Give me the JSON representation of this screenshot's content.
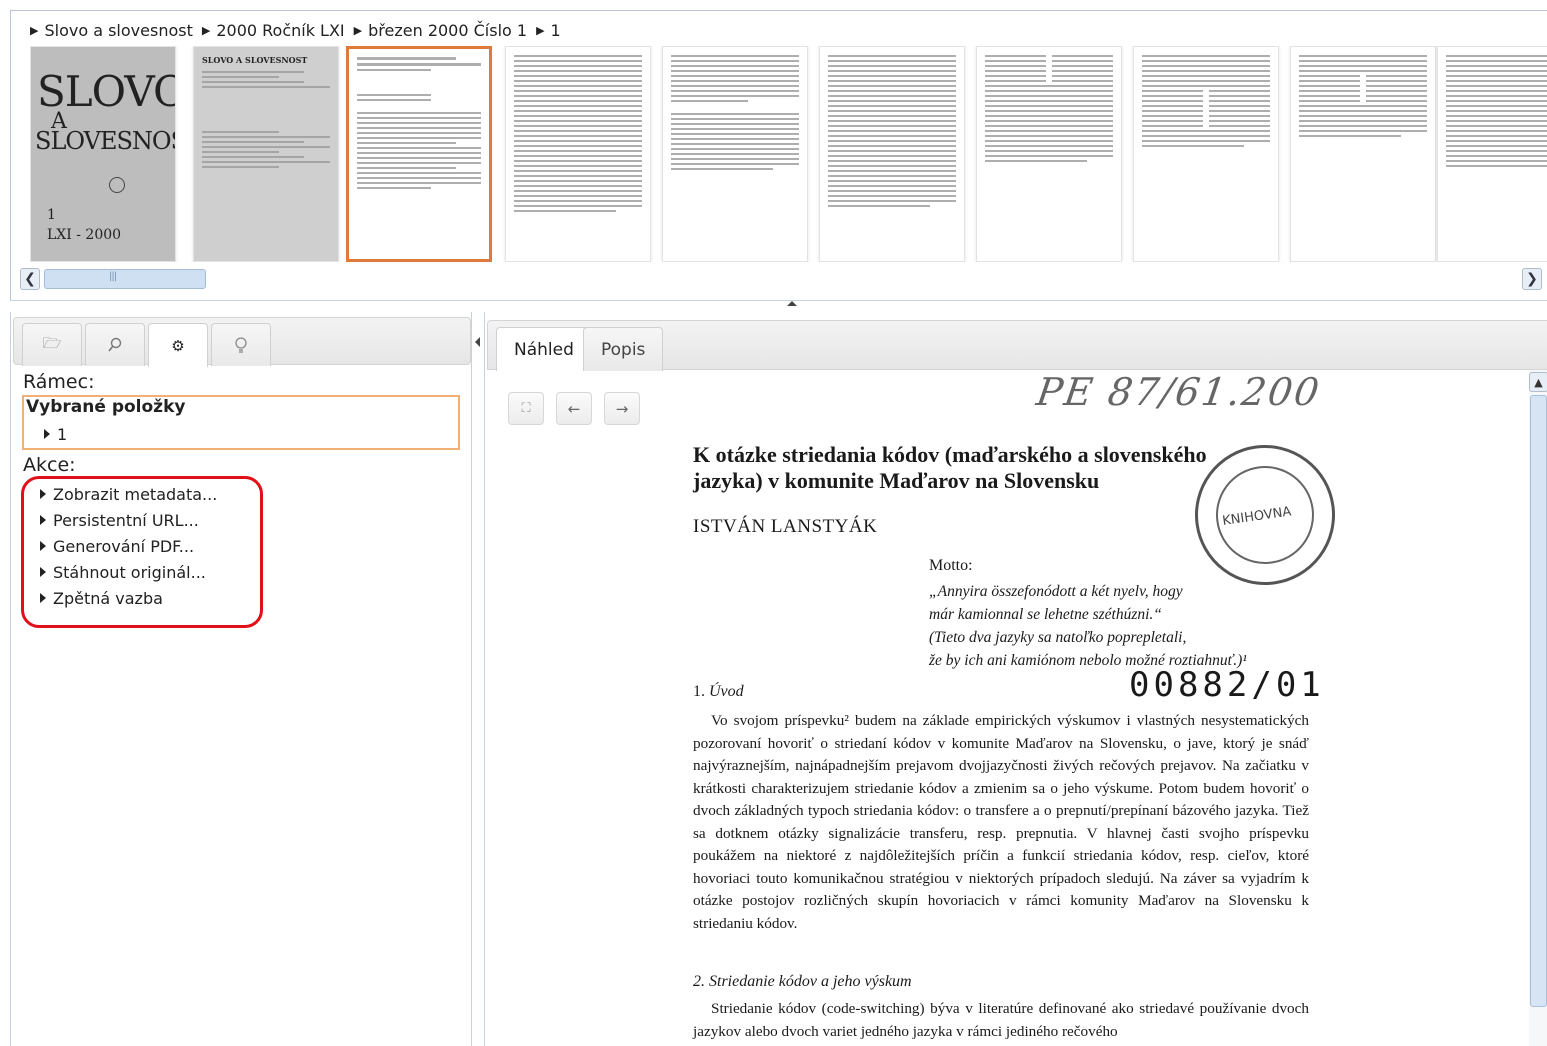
{
  "breadcrumb": [
    "Slovo a slovesnost",
    "2000 Ročník LXI",
    "březen 2000 Číslo 1",
    "1"
  ],
  "thumbnails": {
    "cover_title_1": "SLOVO",
    "cover_title_2": "A",
    "cover_title_3": "SLOVESNOST",
    "cover_issue": "1",
    "cover_volume": "LXI - 2000",
    "second_title": "SLOVO A SLOVESNOST",
    "selected_index": 2
  },
  "left_panel": {
    "tab_icons": [
      "folder-icon",
      "search-icon",
      "gear-icon",
      "bulb-icon"
    ],
    "frame_label": "Rámec:",
    "frame_title": "Vybrané položky",
    "frame_item": "1",
    "actions_label": "Akce:",
    "actions": [
      "Zobrazit metadata...",
      "Persistentní URL...",
      "Generování PDF...",
      "Stáhnout originál...",
      "Zpětná vazba"
    ]
  },
  "right_panel": {
    "tabs": [
      "Náhled",
      "Popis"
    ],
    "active_tab": "Náhled"
  },
  "document": {
    "handwritten_note": "PE 87/61.200",
    "title": "K otázke striedania kódov (maďarského a slovenského jazyka) v komunite Maďarov na Slovensku",
    "author": "ISTVÁN LANSTYÁK",
    "stamp_text": "KNIHOVNA",
    "motto_label": "Motto:",
    "motto_lines": [
      "„Annyira összefonódott a két nyelv, hogy",
      "már kamionnal se lehetne széthúzni.“",
      "(Tieto dva jazyky sa natoľko poprepletali,",
      "že by ich ani kamiónom nebolo možné roztiahnuť.)¹"
    ],
    "section1_number": "1.",
    "section1_title": "Úvod",
    "stamp_number": "00882/01",
    "paragraph1": "Vo svojom príspevku² budem na základe empirických výskumov i vlastných nesystematických pozorovaní hovoriť o striedaní kódov v komunite Maďarov na Slovensku, o jave, ktorý je snáď najvýraznejším, najnápadnejším prejavom dvojjazyčnosti živých rečových prejavov. Na začiatku v krátkosti charakterizujem striedanie kódov a zmienim sa o jeho výskume. Potom budem hovoriť o dvoch základných typoch striedania kódov: o transfere a o prepnutí/prepínaní bázového jazyka. Tiež sa dotknem otázky signalizácie transferu, resp. prepnutia. V hlavnej časti svojho príspevku poukážem na niektoré z najdôležitejších príčin a funkcií striedania kódov, resp. cieľov, ktoré hovoriaci touto komunikačnou stratégiou v niektorých prípadoch sledujú. Na záver sa vyjadrím k otázke postojov rozličných skupín hovoriacich v rámci komunity Maďarov na Slovensku k striedaniu kódov.",
    "section2_title": "2. Striedanie kódov a jeho výskum",
    "paragraph2": "Striedanie kódov (code-switching) býva v literatúre definované ako striedavé používanie dvoch jazykov alebo dvoch variet jedného jazyka v rámci jediného rečového"
  }
}
